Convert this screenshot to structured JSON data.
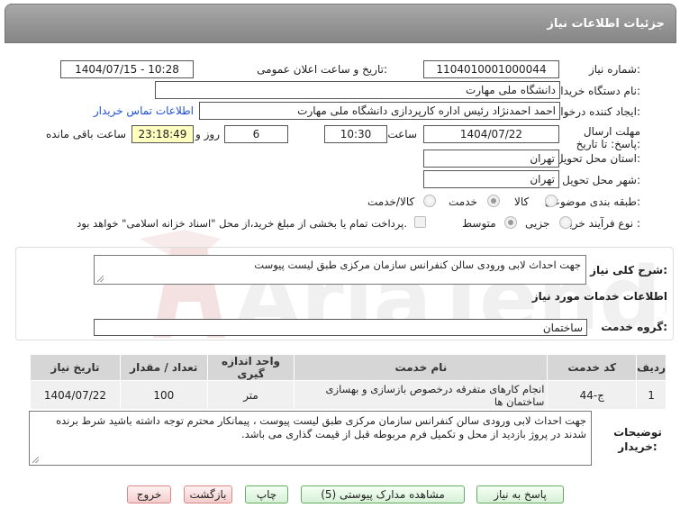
{
  "header": {
    "title": "جزئیات اطلاعات نیاز"
  },
  "watermark": {
    "text": "AriaTender.net"
  },
  "labels": {
    "need_number": "شماره نیاز:",
    "announce_datetime": "تاریخ و ساعت اعلان عمومی:",
    "buyer_org": "نام دستگاه خریدار:",
    "requester": "ایجاد کننده درخواست:",
    "deadline": "مهلت ارسال پاسخ: تا تاریخ:",
    "time_word": "ساعت",
    "days_and": "روز و",
    "remaining": "ساعت باقی مانده",
    "province": "استان محل تحویل:",
    "city": "شهر محل تحویل:",
    "category": "طبقه بندی موضوعی:",
    "process_type": "نوع فرآیند خرید :",
    "general_desc": "شرح کلی نیاز:",
    "services_info": "اطلاعات خدمات مورد نیاز",
    "service_group": "گروه خدمت:",
    "buyer_notes": "توضیحات خریدار:"
  },
  "values": {
    "need_number": "1104010001000044",
    "announce_datetime": "1404/07/15 - 10:28",
    "buyer_org": "دانشگاه ملی مهارت",
    "requester": "احمد احمدنژاد رئیس اداره کارپردازی دانشگاه ملی مهارت",
    "contact_link": "اطلاعات تماس خریدار",
    "deadline_date": "1404/07/22",
    "deadline_time": "10:30",
    "days": "6",
    "remaining_time": "23:18:49",
    "province": "تهران",
    "city": "تهران",
    "general_desc": "جهت احداث لابی ورودی سالن کنفرانس سازمان مرکزی طبق لیست پیوست",
    "service_group": "ساختمان",
    "buyer_notes": "جهت احداث لابی ورودی سالن کنفرانس سازمان مرکزی طبق لیست پیوست ، پیمانکار محترم توجه داشته باشید شرط برنده شدند در پروژ بازدید از محل و تکمیل فرم مربوطه قبل از قیمت گذاری می باشد."
  },
  "category_options": [
    {
      "label": "کالا",
      "selected": false
    },
    {
      "label": "خدمت",
      "selected": true
    },
    {
      "label": "کالا/خدمت",
      "selected": false
    }
  ],
  "process_options": [
    {
      "label": "جزیی",
      "selected": false
    },
    {
      "label": "متوسط",
      "selected": true
    }
  ],
  "payment_note": "پرداخت تمام یا بخشی از مبلغ خرید،از محل \"اسناد خزانه اسلامی\" خواهد بود.",
  "table": {
    "headers": [
      "ردیف",
      "کد خدمت",
      "نام خدمت",
      "واحد اندازه گیری",
      "تعداد / مقدار",
      "تاریخ نیاز"
    ],
    "rows": [
      [
        "1",
        "ج-44",
        "انجام کارهای متفرقه درخصوص بازسازی و بهسازی ساختمان ها",
        "متر",
        "100",
        "1404/07/22"
      ]
    ]
  },
  "buttons": {
    "reply": "پاسخ به نیاز",
    "view_docs": "مشاهده مدارک پیوستی (5)",
    "print": "چاپ",
    "back": "بازگشت",
    "exit": "خروج"
  }
}
